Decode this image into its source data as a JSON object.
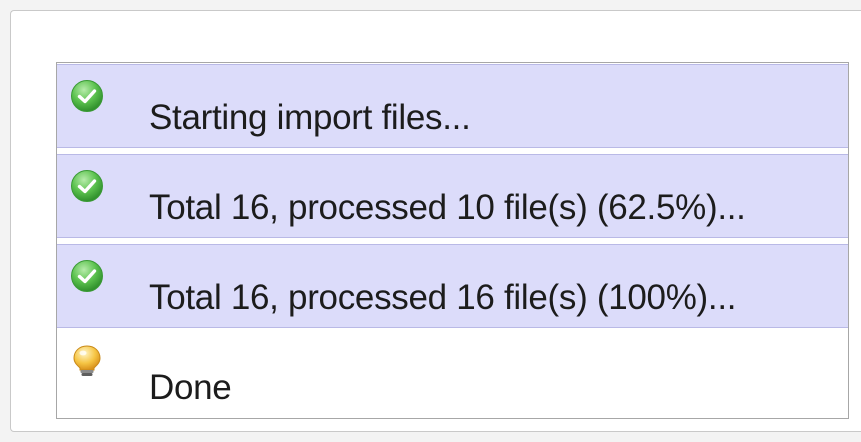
{
  "log": {
    "rows": [
      {
        "status": "success",
        "icon": "check-circle-icon",
        "text": "Starting import files..."
      },
      {
        "status": "success",
        "icon": "check-circle-icon",
        "text": "Total 16, processed 10 file(s) (62.5%)..."
      },
      {
        "status": "success",
        "icon": "check-circle-icon",
        "text": "Total 16, processed 16 file(s) (100%)..."
      },
      {
        "status": "info",
        "icon": "lightbulb-icon",
        "text": "Done"
      }
    ]
  },
  "colors": {
    "success_row_bg": "#dcdcfa",
    "success_icon": "#4fb64c",
    "info_icon": "#f6c544"
  }
}
